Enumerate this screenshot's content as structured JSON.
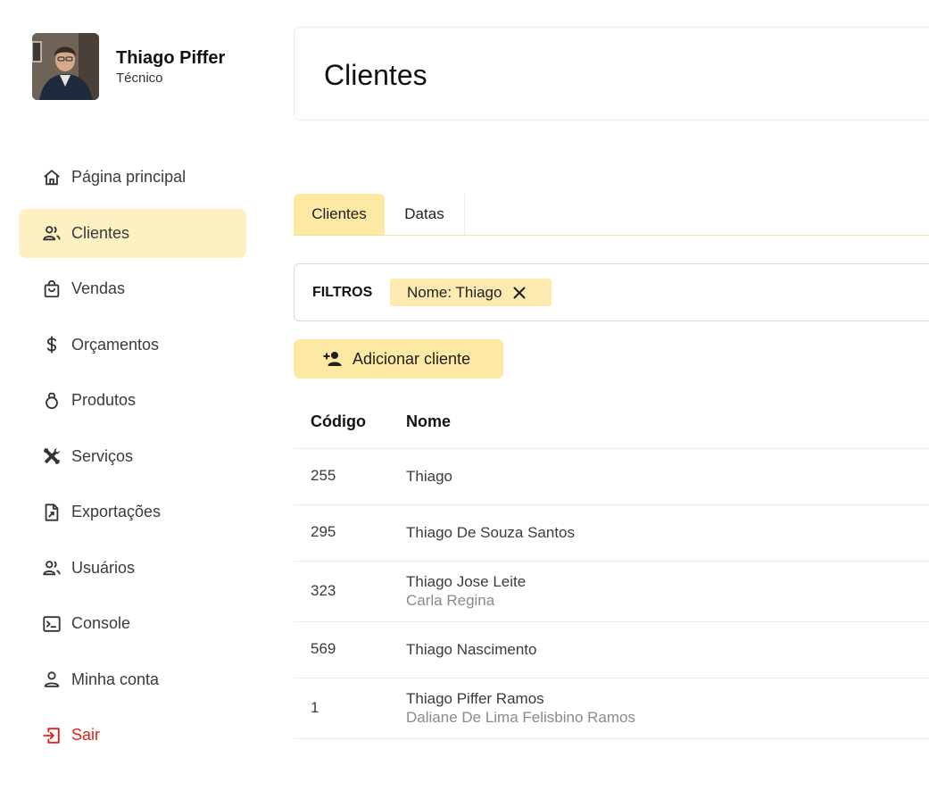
{
  "user": {
    "name": "Thiago Piffer",
    "role": "Técnico"
  },
  "sidebar": {
    "items": [
      {
        "label": "Página principal",
        "icon": "home-icon"
      },
      {
        "label": "Clientes",
        "icon": "users-icon",
        "active": true
      },
      {
        "label": "Vendas",
        "icon": "shopping-bag-icon"
      },
      {
        "label": "Orçamentos",
        "icon": "dollar-icon"
      },
      {
        "label": "Produtos",
        "icon": "ring-icon"
      },
      {
        "label": "Serviços",
        "icon": "tools-icon"
      },
      {
        "label": "Exportações",
        "icon": "file-export-icon"
      },
      {
        "label": "Usuários",
        "icon": "users-icon"
      },
      {
        "label": "Console",
        "icon": "terminal-icon"
      },
      {
        "label": "Minha conta",
        "icon": "person-icon"
      },
      {
        "label": "Sair",
        "icon": "logout-icon"
      }
    ]
  },
  "header": {
    "title": "Clientes"
  },
  "tabs": [
    {
      "label": "Clientes",
      "active": true
    },
    {
      "label": "Datas"
    }
  ],
  "filters": {
    "label": "FILTROS",
    "chips": [
      {
        "label": "Nome: Thiago"
      }
    ]
  },
  "actions": {
    "add_label": "Adicionar cliente"
  },
  "table": {
    "columns": [
      "Código",
      "Nome"
    ],
    "rows": [
      {
        "code": "255",
        "name": "Thiago",
        "subtitle": ""
      },
      {
        "code": "295",
        "name": "Thiago De Souza Santos",
        "subtitle": ""
      },
      {
        "code": "323",
        "name": "Thiago Jose Leite",
        "subtitle": "Carla Regina"
      },
      {
        "code": "569",
        "name": "Thiago Nascimento",
        "subtitle": ""
      },
      {
        "code": "1",
        "name": "Thiago Piffer Ramos",
        "subtitle": "Daliane De Lima Felisbino Ramos"
      }
    ]
  },
  "colors": {
    "accent": "#fde9a3",
    "accent_light": "#fdf0c3",
    "danger": "#e0201b"
  }
}
